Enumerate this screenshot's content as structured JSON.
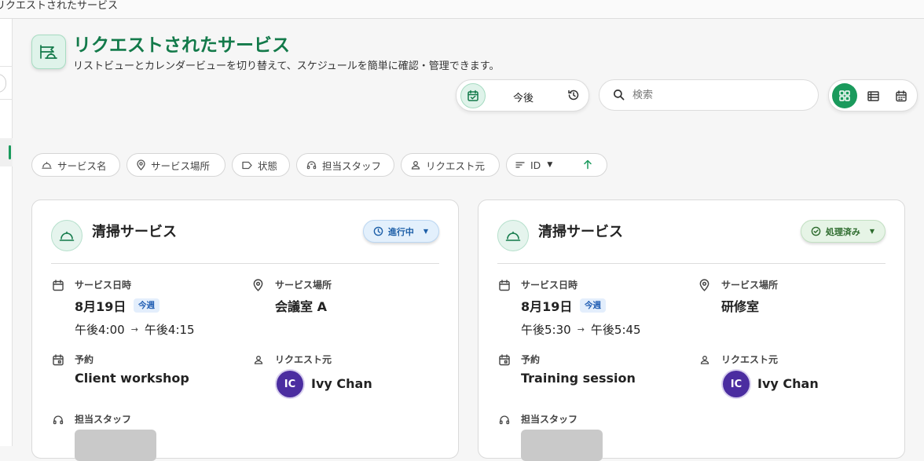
{
  "window": {
    "title": "リクエストされたサービス"
  },
  "header": {
    "title": "リクエストされたサービス",
    "subtitle": "リストビューとカレンダービューを切り替えて、スケジュールを簡単に確認・管理できます。",
    "icon": "service-bell-sign-icon"
  },
  "toolbar": {
    "period_label": "今後",
    "search_placeholder": "検索",
    "views": [
      "grid-view-icon",
      "list-view-icon",
      "calendar-view-icon"
    ],
    "active_view": "grid"
  },
  "filters": {
    "items": [
      {
        "label": "サービス名",
        "icon": "bell-icon"
      },
      {
        "label": "サービス場所",
        "icon": "location-pin-icon"
      },
      {
        "label": "状態",
        "icon": "tag-icon"
      },
      {
        "label": "担当スタッフ",
        "icon": "headset-icon"
      },
      {
        "label": "リクエスト元",
        "icon": "person-icon"
      }
    ],
    "sort": {
      "label": "ID",
      "direction": "ascending"
    }
  },
  "fields": {
    "date": "サービス日時",
    "place": "サービス場所",
    "booking": "予約",
    "requester": "リクエスト元",
    "staff": "担当スタッフ"
  },
  "cards": [
    {
      "title": "清掃サービス",
      "status": "進行中",
      "status_color": "#1d5fa8",
      "date": "8月19日",
      "badge": "今週",
      "start": "午後4:00",
      "end": "午後4:15",
      "place": "会議室 A",
      "booking": "Client workshop",
      "requester_initials": "IC",
      "requester_name": "Ivy Chan"
    },
    {
      "title": "清掃サービス",
      "status": "処理済み",
      "status_color": "#2d6b2d",
      "date": "8月19日",
      "badge": "今週",
      "start": "午後5:30",
      "end": "午後5:45",
      "place": "研修室",
      "booking": "Training session",
      "requester_initials": "IC",
      "requester_name": "Ivy Chan"
    }
  ],
  "colors": {
    "accent": "#1a9a5c",
    "title": "#137a4a",
    "avatar": "#4b2da0"
  }
}
